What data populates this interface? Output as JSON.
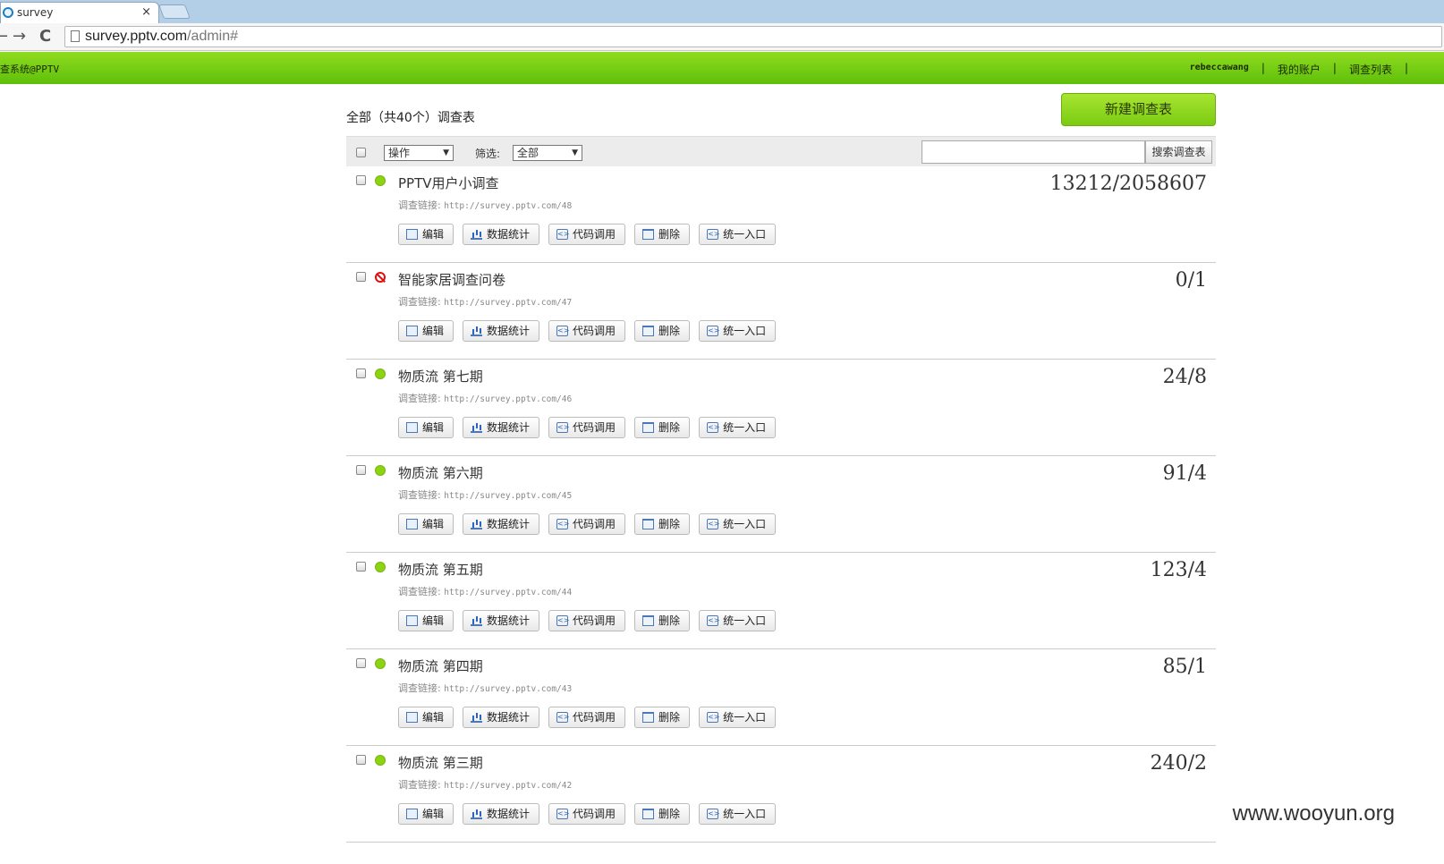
{
  "browser": {
    "tab_title": "survey",
    "tab_close": "×",
    "back": "←",
    "forward": "→",
    "reload": "C",
    "url_host": "survey.pptv.com",
    "url_path": "/admin#"
  },
  "header": {
    "app_title": "查系统@PPTV",
    "username": "rebeccawang",
    "my_account": "我的账户",
    "survey_list": "调查列表",
    "separator": "|"
  },
  "main": {
    "summary": "全部（共40个）调查表",
    "create_button": "新建调查表",
    "toolbar": {
      "action_select": "操作",
      "filter_label": "筛选:",
      "filter_select": "全部",
      "search_placeholder": "",
      "search_button": "搜索调查表"
    },
    "link_label": "调查链接:",
    "action_labels": {
      "edit": "编辑",
      "stats": "数据统计",
      "code": "代码调用",
      "delete": "删除",
      "entry": "统一入口"
    },
    "surveys": [
      {
        "title": "PPTV用户小调查",
        "url": "http://survey.pptv.com/48",
        "count": "13212/2058607",
        "status": "active"
      },
      {
        "title": "智能家居调查问卷",
        "url": "http://survey.pptv.com/47",
        "count": "0/1",
        "status": "stopped"
      },
      {
        "title": "物质流 第七期",
        "url": "http://survey.pptv.com/46",
        "count": "24/8",
        "status": "active"
      },
      {
        "title": "物质流 第六期",
        "url": "http://survey.pptv.com/45",
        "count": "91/4",
        "status": "active"
      },
      {
        "title": "物质流 第五期",
        "url": "http://survey.pptv.com/44",
        "count": "123/4",
        "status": "active"
      },
      {
        "title": "物质流 第四期",
        "url": "http://survey.pptv.com/43",
        "count": "85/1",
        "status": "active"
      },
      {
        "title": "物质流 第三期",
        "url": "http://survey.pptv.com/42",
        "count": "240/2",
        "status": "active"
      }
    ]
  },
  "colors": {
    "header_green": "#6fcc12",
    "status_active": "#8cd313",
    "status_stopped": "#e01010"
  },
  "icons": [
    "edit-icon",
    "stats-icon",
    "code-icon",
    "delete-icon",
    "entry-icon",
    "checkbox",
    "status-active-icon",
    "status-stopped-icon"
  ],
  "watermark": "www.wooyun.org"
}
